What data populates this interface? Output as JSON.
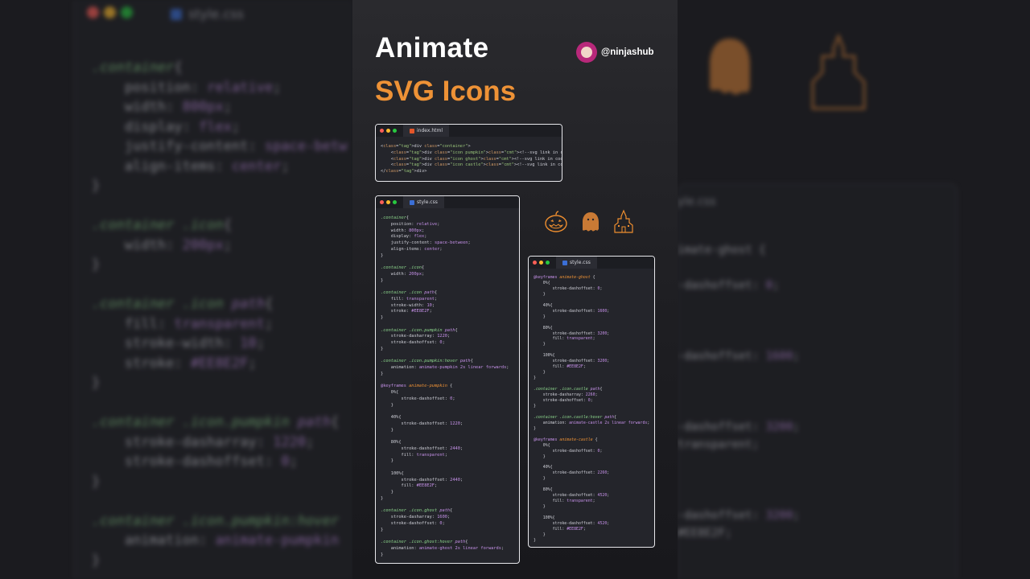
{
  "title": {
    "line1": "Animate",
    "line2": "SVG Icons"
  },
  "author": {
    "handle": "@ninjashub"
  },
  "colors": {
    "accent": "#ee9236",
    "bg": "#1b1b1f",
    "window": "#24252b",
    "icon_fill": "#EE8E2F"
  },
  "html_window": {
    "tab": "index.html",
    "lines": [
      "<div class=\"container\">",
      "    <div class=\"icon pumpkin\"><!--svg link in codepen--></div>",
      "    <div class=\"icon ghost\"><!--svg link in codepen--></div>",
      "    <div class=\"icon castle\"><!--svg link in codepen--></div>",
      "</div>"
    ]
  },
  "css_window_1": {
    "tab": "style.css",
    "lines": [
      ".container{",
      "    position: relative;",
      "    width: 800px;",
      "    display: flex;",
      "    justify-content: space-between;",
      "    align-items: center;",
      "}",
      "",
      ".container .icon{",
      "    width: 200px;",
      "}",
      "",
      ".container .icon path{",
      "    fill: transparent;",
      "    stroke-width: 10;",
      "    stroke: #EE8E2F;",
      "}",
      "",
      ".container .icon.pumpkin path{",
      "    stroke-dasharray: 1220;",
      "    stroke-dashoffset: 0;",
      "}",
      "",
      ".container .icon.pumpkin:hover path{",
      "    animation: animate-pumpkin 2s linear forwards;",
      "}",
      "",
      "@keyframes animate-pumpkin {",
      "    0%{",
      "        stroke-dashoffset: 0;",
      "    }",
      "",
      "    40%{",
      "        stroke-dashoffset: 1220;",
      "    }",
      "",
      "    80%{",
      "        stroke-dashoffset: 2440;",
      "        fill: transparent;",
      "    }",
      "",
      "    100%{",
      "        stroke-dashoffset: 2440;",
      "        fill: #EE8E2F;",
      "    }",
      "}",
      "",
      ".container .icon.ghost path{",
      "    stroke-dasharray: 1600;",
      "    stroke-dashoffset: 0;",
      "}",
      "",
      ".container .icon.ghost:hover path{",
      "    animation: animate-ghost 2s linear forwards;",
      "}"
    ]
  },
  "css_window_2": {
    "tab": "style.css",
    "lines": [
      "@keyframes animate-ghost {",
      "    0%{",
      "        stroke-dashoffset: 0;",
      "    }",
      "",
      "    40%{",
      "        stroke-dashoffset: 1600;",
      "    }",
      "",
      "    80%{",
      "        stroke-dashoffset: 3200;",
      "        fill: transparent;",
      "    }",
      "",
      "    100%{",
      "        stroke-dashoffset: 3200;",
      "        fill: #EE8E2F;",
      "    }",
      "}",
      "",
      ".container .icon.castle path{",
      "    stroke-dasharray: 2260;",
      "    stroke-dashoffset: 0;",
      "}",
      "",
      ".container .icon.castle:hover path{",
      "    animation: animate-castle 2s linear forwards;",
      "}",
      "",
      "@keyframes animate-castle {",
      "    0%{",
      "        stroke-dashoffset: 0;",
      "    }",
      "",
      "    40%{",
      "        stroke-dashoffset: 2260;",
      "    }",
      "",
      "    80%{",
      "        stroke-dashoffset: 4520;",
      "        fill: transparent;",
      "    }",
      "",
      "    100%{",
      "        stroke-dashoffset: 4520;",
      "        fill: #EE8E2F;",
      "    }",
      "}"
    ]
  },
  "bg_left": {
    "tab": "style.css",
    "lines": [
      ".container{",
      "    position: relative;",
      "    width: 800px;",
      "    display: flex;",
      "    justify-content: space-betw",
      "    align-items: center;",
      "}",
      "",
      ".container .icon{",
      "    width: 200px;",
      "}",
      "",
      ".container .icon path{",
      "    fill: transparent;",
      "    stroke-width: 10;",
      "    stroke: #EE8E2F;",
      "}",
      "",
      ".container .icon.pumpkin path{",
      "    stroke-dasharray: 1220;",
      "    stroke-dashoffset: 0;",
      "}",
      "",
      ".container .icon.pumpkin:hover",
      "    animation: animate-pumpkin",
      "}"
    ]
  },
  "bg_right": {
    "tab": "yle.css",
    "lines": [
      "imate-ghost {",
      "",
      "-dashoffset: 0;",
      "",
      "",
      "",
      "-dashoffset: 1600;",
      "",
      "",
      "",
      "-dashoffset: 3200;",
      "transparent;",
      "",
      "",
      "",
      "-dashoffset: 3200;",
      "#EE8E2F;"
    ]
  },
  "icons": [
    "pumpkin-icon",
    "ghost-icon",
    "castle-icon"
  ]
}
